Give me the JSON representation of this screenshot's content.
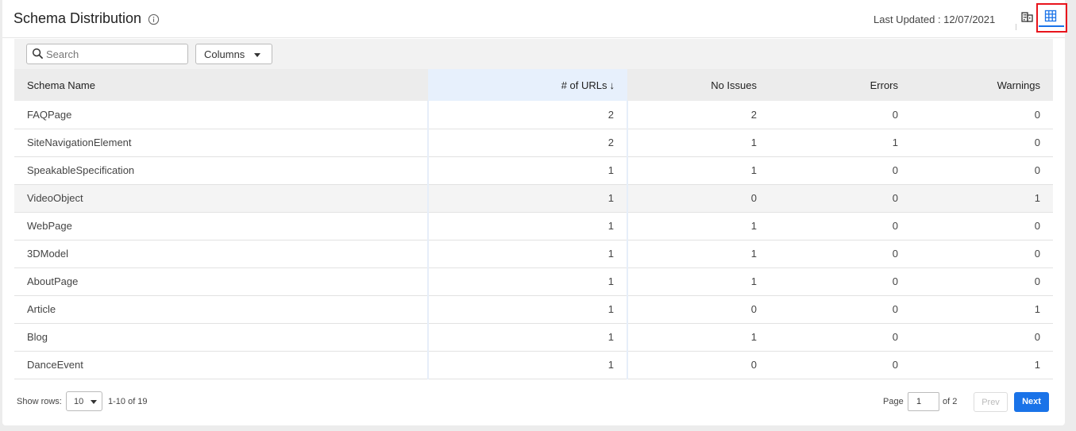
{
  "header": {
    "title": "Schema Distribution",
    "last_updated": "Last Updated : 12/07/2021"
  },
  "toolbar": {
    "search_placeholder": "Search",
    "columns_label": "Columns"
  },
  "table": {
    "columns": [
      "Schema Name",
      "# of URLs",
      "No Issues",
      "Errors",
      "Warnings"
    ],
    "sorted_column": "# of URLs",
    "rows": [
      {
        "name": "FAQPage",
        "urls": "2",
        "no_issues": "2",
        "errors": "0",
        "warnings": "0"
      },
      {
        "name": "SiteNavigationElement",
        "urls": "2",
        "no_issues": "1",
        "errors": "1",
        "warnings": "0"
      },
      {
        "name": "SpeakableSpecification",
        "urls": "1",
        "no_issues": "1",
        "errors": "0",
        "warnings": "0"
      },
      {
        "name": "VideoObject",
        "urls": "1",
        "no_issues": "0",
        "errors": "0",
        "warnings": "1"
      },
      {
        "name": "WebPage",
        "urls": "1",
        "no_issues": "1",
        "errors": "0",
        "warnings": "0"
      },
      {
        "name": "3DModel",
        "urls": "1",
        "no_issues": "1",
        "errors": "0",
        "warnings": "0"
      },
      {
        "name": "AboutPage",
        "urls": "1",
        "no_issues": "1",
        "errors": "0",
        "warnings": "0"
      },
      {
        "name": "Article",
        "urls": "1",
        "no_issues": "0",
        "errors": "0",
        "warnings": "1"
      },
      {
        "name": "Blog",
        "urls": "1",
        "no_issues": "1",
        "errors": "0",
        "warnings": "0"
      },
      {
        "name": "DanceEvent",
        "urls": "1",
        "no_issues": "0",
        "errors": "0",
        "warnings": "1"
      }
    ]
  },
  "footer": {
    "show_rows_label": "Show rows:",
    "rows_per_page": "10",
    "range_text": "1-10 of 19",
    "page_label": "Page",
    "current_page": "1",
    "of_pages": "of 2",
    "prev_label": "Prev",
    "next_label": "Next"
  },
  "colors": {
    "accent": "#1a73e8",
    "highlight_box": "#e8141c"
  }
}
